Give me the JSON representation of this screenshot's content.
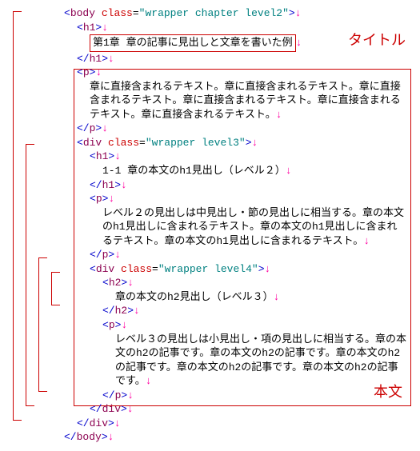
{
  "labels": {
    "title": "タイトル",
    "body": "本文"
  },
  "code": {
    "body_open_tag": "body",
    "body_open_class_attr": "class",
    "body_open_class_val": "\"wrapper chapter level2\"",
    "h1a_open": "h1",
    "h1a_text": "第1章 章の記事に見出しと文章を書いた例",
    "h1a_close": "h1",
    "p1_open": "p",
    "p1_text": "章に直接含まれるテキスト。章に直接含まれるテキスト。章に直接含まれるテキスト。章に直接含まれるテキスト。章に直接含まれるテキスト。章に直接含まれるテキスト。",
    "p1_close": "p",
    "div3_tag": "div",
    "div3_attr": "class",
    "div3_val": "\"wrapper level3\"",
    "h1b_open": "h1",
    "h1b_text": "1-1 章の本文のh1見出し（レベル２）",
    "h1b_close": "h1",
    "p2_open": "p",
    "p2_text": "レベル２の見出しは中見出し・節の見出しに相当する。章の本文のh1見出しに含まれるテキスト。章の本文のh1見出しに含まれるテキスト。章の本文のh1見出しに含まれるテキスト。",
    "p2_close": "p",
    "div4_tag": "div",
    "div4_attr": "class",
    "div4_val": "\"wrapper level4\"",
    "h2_open": "h2",
    "h2_text": "章の本文のh2見出し（レベル３）",
    "h2_close": "h2",
    "p3_open": "p",
    "p3_text": "レベル３の見出しは小見出し・項の見出しに相当する。章の本文のh2の記事です。章の本文のh2の記事です。章の本文のh2の記事です。章の本文のh2の記事です。章の本文のh2の記事です。",
    "p3_close": "p",
    "div4_close": "div",
    "div3_close": "div",
    "body_close": "body"
  }
}
